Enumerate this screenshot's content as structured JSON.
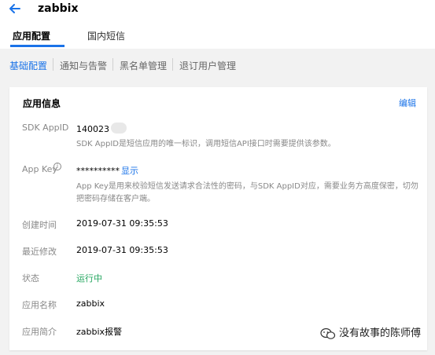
{
  "header": {
    "app_title": "zabbix",
    "tabs": [
      {
        "label": "应用配置"
      },
      {
        "label": "国内短信"
      }
    ]
  },
  "subnav": [
    {
      "label": "基础配置"
    },
    {
      "label": "通知与告警"
    },
    {
      "label": "黑名单管理"
    },
    {
      "label": "退订用户管理"
    }
  ],
  "card": {
    "title": "应用信息",
    "edit_label": "编辑",
    "rows": {
      "sdk_appid": {
        "label": "SDK AppID",
        "value": "140023",
        "hint": "SDK AppID是短信应用的唯一标识，调用短信API接口时需要提供该参数。"
      },
      "app_key": {
        "label": "App Key",
        "value": "**********",
        "show_label": "显示",
        "hint": "App Key是用来校验短信发送请求合法性的密码，与SDK AppID对应，需要业务方高度保密，切勿把密码存储在客户端。"
      },
      "created": {
        "label": "创建时间",
        "value": "2019-07-31 09:35:53"
      },
      "modified": {
        "label": "最近修改",
        "value": "2019-07-31 09:35:53"
      },
      "status": {
        "label": "状态",
        "value": "运行中"
      },
      "app_name": {
        "label": "应用名称",
        "value": "zabbix"
      },
      "app_desc": {
        "label": "应用简介",
        "value": "zabbix报警"
      }
    }
  },
  "watermark": "没有故事的陈师傅",
  "colors": {
    "accent": "#1a73e8",
    "status_running": "#22a55e"
  }
}
